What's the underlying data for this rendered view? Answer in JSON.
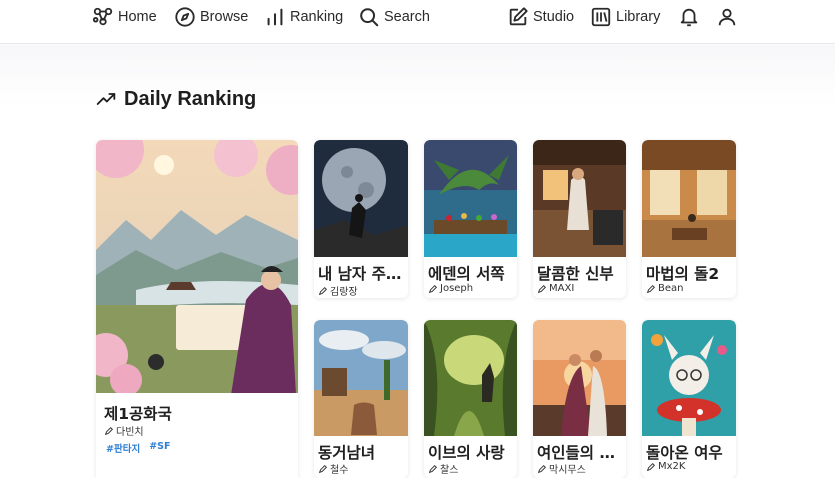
{
  "nav": {
    "home_label": "Home",
    "browse_label": "Browse",
    "ranking_label": "Ranking",
    "search_label": "Search",
    "studio_label": "Studio",
    "library_label": "Library",
    "icons": [
      "logo-icon",
      "compass-icon",
      "bar-chart-icon",
      "search-icon",
      "edit-icon",
      "library-icon",
      "bell-icon",
      "user-icon"
    ]
  },
  "section": {
    "title": "Daily Ranking",
    "icon": "trending-up-icon"
  },
  "featured": {
    "title": "제1공화국",
    "author": "다빈치",
    "tags": [
      "#판타지",
      "#SF"
    ]
  },
  "cards": [
    {
      "title": "내 남자 주인공이 바뀌었다",
      "author": "김랑장"
    },
    {
      "title": "에덴의 서쪽",
      "author": "Joseph"
    },
    {
      "title": "달콤한 신부",
      "author": "MAXI"
    },
    {
      "title": "마법의 돌2",
      "author": "Bean"
    },
    {
      "title": "동거남녀",
      "author": "철수"
    },
    {
      "title": "이브의 사랑",
      "author": "찰스"
    },
    {
      "title": "여인들의 이야기",
      "author": "막시무스"
    },
    {
      "title": "돌아온 여우",
      "author": "Mx2K"
    }
  ],
  "colors": {
    "accent": "#2f7fd4",
    "text": "#1f1f1f",
    "background": "#ffffff"
  }
}
